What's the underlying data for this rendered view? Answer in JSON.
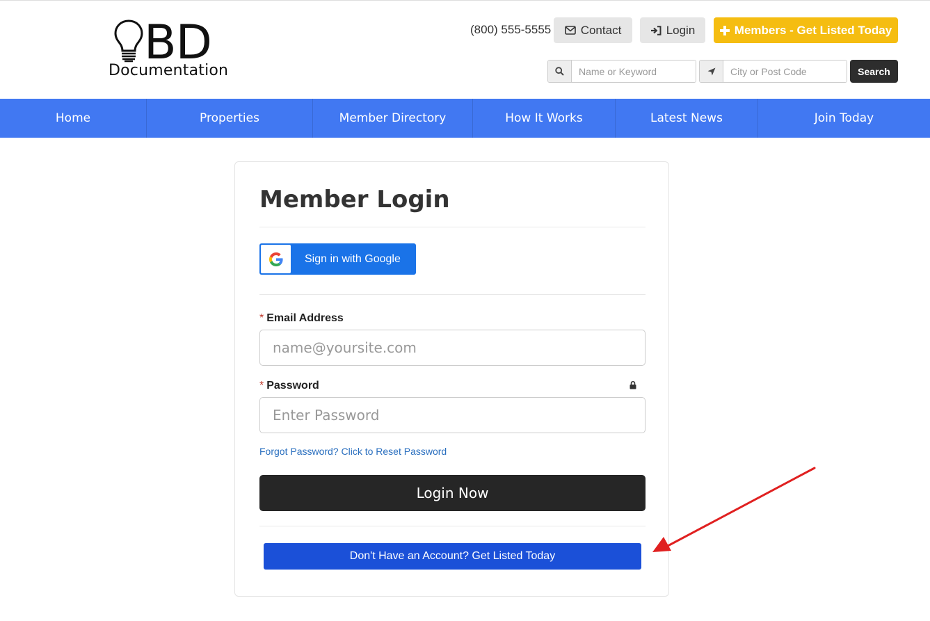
{
  "header": {
    "logo": {
      "line1": "BD",
      "line2": "Documentation"
    },
    "phone": "(800) 555-5555",
    "contact_label": "Contact",
    "login_label": "Login",
    "members_label": "Members - Get Listed Today",
    "search": {
      "keyword_placeholder": "Name or Keyword",
      "location_placeholder": "City or Post Code",
      "button_label": "Search"
    }
  },
  "nav": {
    "items": [
      {
        "label": "Home"
      },
      {
        "label": "Properties"
      },
      {
        "label": "Member Directory"
      },
      {
        "label": "How It Works"
      },
      {
        "label": "Latest News"
      },
      {
        "label": "Join Today"
      }
    ]
  },
  "login_form": {
    "title": "Member Login",
    "google_label": "Sign in with Google",
    "required_marker": "*",
    "email_label": "Email Address",
    "email_placeholder": "name@yoursite.com",
    "password_label": "Password",
    "password_placeholder": "Enter Password",
    "forgot_link": "Forgot Password? Click to Reset Password",
    "login_button": "Login Now",
    "get_listed_button": "Don't Have an Account? Get Listed Today"
  },
  "icons": {
    "contact": "envelope-icon",
    "login": "sign-in-icon",
    "members": "plus-icon",
    "keyword": "search-icon",
    "location": "location-arrow-icon",
    "password": "lock-icon",
    "google": "google-g-icon",
    "annotation": "red-arrow-icon"
  },
  "colors": {
    "nav_bg": "#4178f2",
    "members_btn": "#f5bd11",
    "google_btn": "#1a73e8",
    "login_btn": "#262626",
    "get_listed_btn": "#1b50d8",
    "annotation_arrow": "#e02020"
  }
}
